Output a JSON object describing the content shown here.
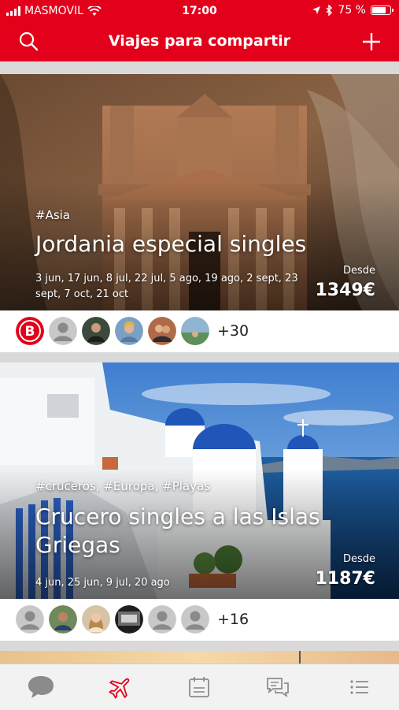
{
  "status_bar": {
    "carrier": "MASMOVIL",
    "time": "17:00",
    "battery": "75 %"
  },
  "header": {
    "title": "Viajes para compartir",
    "search_icon": "search-icon",
    "add_icon": "plus-icon"
  },
  "trips": [
    {
      "tags": "#Asia",
      "title": "Jordania especial singles",
      "dates": "3 jun, 17 jun, 8 jul, 22 jul, 5 ago, 19 ago, 2 sept, 23 sept, 7 oct, 21 oct",
      "price_label": "Desde",
      "price": "1349€",
      "extra_members": "+30"
    },
    {
      "tags": "#cruceros, #Europa, #Playas",
      "title": "Crucero singles a las Islas Griegas",
      "dates": "4 jun, 25 jun, 9 jul, 20 ago",
      "price_label": "Desde",
      "price": "1187€",
      "extra_members": "+16"
    }
  ],
  "organizer_badge": "B",
  "tab_bar": [
    "chat-bubble-icon",
    "airplane-icon",
    "calendar-icon",
    "messages-icon",
    "list-icon"
  ],
  "colors": {
    "brand": "#e3001b"
  }
}
